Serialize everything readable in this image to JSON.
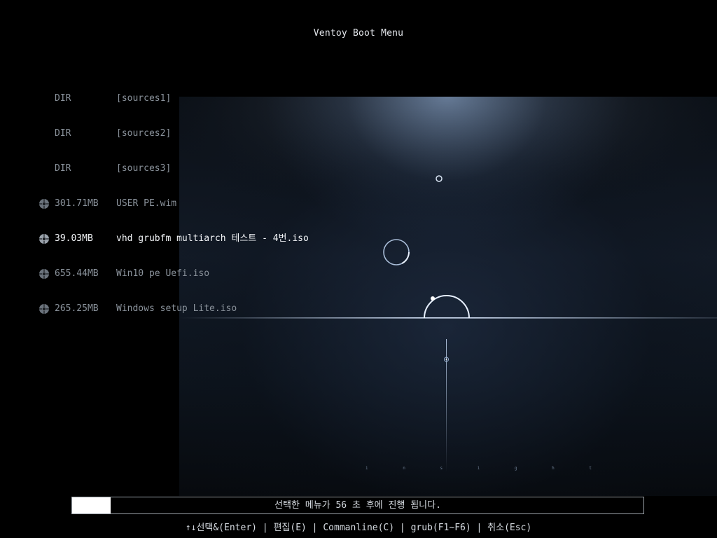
{
  "title": "Ventoy Boot Menu",
  "menu": {
    "items": [
      {
        "type": "dir",
        "size": "DIR",
        "name": "[sources1]",
        "selected": false
      },
      {
        "type": "dir",
        "size": "DIR",
        "name": "[sources2]",
        "selected": false
      },
      {
        "type": "dir",
        "size": "DIR",
        "name": "[sources3]",
        "selected": false
      },
      {
        "type": "file",
        "icon": "disc-icon",
        "size": "301.71MB",
        "name": "USER PE.wim",
        "selected": false
      },
      {
        "type": "file",
        "icon": "disc-icon",
        "size": "39.03MB",
        "name": "vhd grubfm multiarch 테스트 - 4번.iso",
        "selected": true
      },
      {
        "type": "file",
        "icon": "disc-icon",
        "size": "655.44MB",
        "name": "Win10 pe Uefi.iso",
        "selected": false
      },
      {
        "type": "file",
        "icon": "disc-icon",
        "size": "265.25MB",
        "name": "Windows setup Lite.iso",
        "selected": false
      }
    ]
  },
  "countdown": {
    "text": "선택한 메뉴가 56 초 후에 진행 됩니다.",
    "progress": 0.067
  },
  "hotkeys": {
    "select": "↑↓선택&(Enter)",
    "edit": "편집(E)",
    "cmdline": "Commanline(C)",
    "grub": "grub(F1~F6)",
    "cancel": "취소(Esc)"
  },
  "wallpaper": {
    "caption": "i n s i g h t"
  },
  "colors": {
    "background": "#000000",
    "selected_text": "#f2f4f7",
    "normal_text": "#8a929b",
    "accent_line": "#cfe3ff"
  }
}
